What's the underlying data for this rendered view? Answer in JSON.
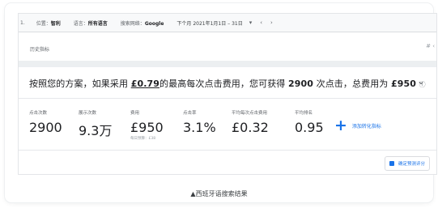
{
  "toolbar": {
    "cut_label": "1.",
    "location_label": "位置：",
    "location_value": "智利",
    "language_label": "语言：",
    "language_value": "所有语言",
    "network_label": "搜索网络：",
    "network_value": "Google",
    "period_label": "下个月",
    "date_range": "2021年1月1日 – 31日",
    "dropdown_icon": "▾",
    "prev_icon": "‹",
    "next_icon": "›"
  },
  "history": {
    "label": "历史指标",
    "edge_text": "# ‹"
  },
  "sentence": {
    "prefix": "按照您的方案，如果采用 ",
    "max_cpc": "£0.79",
    "middle": "的最高每次点击费用，您可获得 ",
    "clicks": "2900",
    "clicks_suffix": " 次点击，总费用为 ",
    "cost": "£950",
    "help_icon": "ⓘ",
    "chevron": "⌄"
  },
  "metrics": {
    "clicks": {
      "label": "点击次数",
      "value": "2900"
    },
    "impressions": {
      "label": "展示次数",
      "value": "9.3万"
    },
    "cost": {
      "label": "费用",
      "value": "£950",
      "sub": "每日预算：£38"
    },
    "ctr": {
      "label": "点击率",
      "value": "3.1%"
    },
    "avg_cpc": {
      "label": "平均每次点击费用",
      "value": "£0.32"
    },
    "avg_position": {
      "label": "平均排名",
      "value": "0.95"
    }
  },
  "add_conversion": {
    "icon": "+",
    "label": "添加转化指标"
  },
  "predict_button": {
    "label": "确定预测评分"
  },
  "caption": "▲西班牙语搜索结果",
  "colors": {
    "accent": "#1a73e8",
    "text": "#202124",
    "muted": "#5f6368"
  }
}
